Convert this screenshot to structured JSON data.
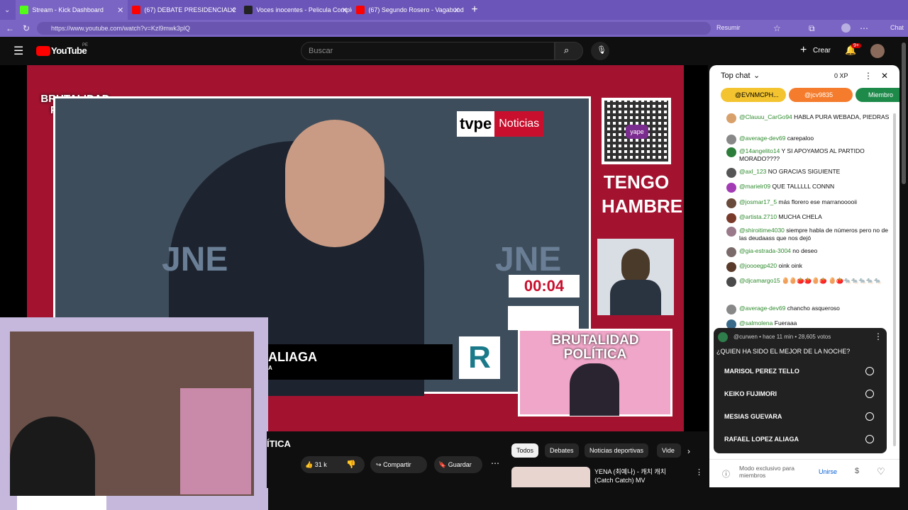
{
  "tabs": [
    {
      "title": "Stream - Kick Dashboard",
      "color": "#53fc18"
    },
    {
      "title": "(67) DEBATE PRESIDENCIAL 2",
      "color": "#ff0000"
    },
    {
      "title": "Voces inocentes - Pelicula Complet",
      "color": "#222222"
    },
    {
      "title": "(67) Segundo Rosero - Vagabunde",
      "color": "#ff0000"
    }
  ],
  "browser": {
    "url": "https://www.youtube.com/watch?v=Kzl9mwk3plQ",
    "resume": "Resumir",
    "chat": "Chat",
    "new_tab": "+"
  },
  "youtube": {
    "logo": "YouTube",
    "region": "PE",
    "search_placeholder": "Buscar",
    "create": "Crear",
    "notif": "9+"
  },
  "video": {
    "brand": "BRUTALIDAD POLÍTICA",
    "tv": "tvpe",
    "tv2": "Noticias",
    "timer": "00:04",
    "name": "ALIAGA",
    "name_sub": "A",
    "hunger": "TENGO HAMBRE",
    "qr_label": "yape",
    "pip_brand": "BRUTALIDAD POLÍTICA",
    "jne": "JNE",
    "jne2": "JNE",
    "badge": "R"
  },
  "below": {
    "title_fragment": "ÍTICA",
    "likes": "31 k",
    "share": "Compartir",
    "save": "Guardar",
    "chips": [
      "Todos",
      "Debates",
      "Noticias deportivas",
      "Vide"
    ],
    "rec_title": "YENA (최예나) - 캐치 캐치 (Catch Catch) MV"
  },
  "chat": {
    "header": "Top chat",
    "xp": "0 XP",
    "pinned": [
      "@EVNMCPH...",
      "@jcv9835",
      "Miembro"
    ],
    "messages": [
      {
        "user": "@Clauuu_CarGo94",
        "text": "HABLA PURA WEBADA, PIEDRAS",
        "color": "#d8a06a"
      },
      {
        "user": "@average-dev69",
        "text": "carepaloo",
        "color": "#888"
      },
      {
        "user": "@14angelito14",
        "text": "Y SI APOYAMOS AL PARTIDO MORADO????",
        "color": "#2d7d3a"
      },
      {
        "user": "@axl_123",
        "text": "NO GRACIAS SIGUIENTE",
        "color": "#555"
      },
      {
        "user": "@marielr09",
        "text": "QUE TALLLLL CONNN",
        "color": "#a33bb5"
      },
      {
        "user": "@josmar17_5",
        "text": "más florero ese marranooooii",
        "color": "#6a4a3a"
      },
      {
        "user": "@artista.2710",
        "text": "MUCHA CHELA",
        "color": "#7a3a2a"
      },
      {
        "user": "@shiroitime4030",
        "text": "siempre habla de números pero no de las deudaass que nos dejó",
        "color": "#9a7a8a"
      },
      {
        "user": "@gia-estrada-3004",
        "text": "no deseo",
        "color": "#7a6a6a"
      },
      {
        "user": "@joooegp420",
        "text": "oink oink",
        "color": "#5a3a2a"
      },
      {
        "user": "@djcamargo15",
        "text": "🥚🥚🍅🍅🥚🍅 🥚🍅🐀🐀🐀🐀🐀",
        "color": "#4a4a4a"
      },
      {
        "user": "@average-dev69",
        "text": "chancho asqueroso",
        "color": "#888"
      },
      {
        "user": "@salmolena",
        "text": "Fueraaa",
        "color": "#3a6a8a"
      }
    ],
    "poll": {
      "meta": "@curwen • hace 11 min • 28,605 votos",
      "question": "¿QUIEN HA SIDO EL MEJOR DE LA NOCHE?",
      "options": [
        "MARISOL PEREZ TELLO",
        "KEIKO FUJIMORI",
        "MESIAS GUEVARA",
        "RAFAEL LOPEZ ALIAGA"
      ]
    },
    "footer": "Modo exclusivo para miembros",
    "join": "Unirse"
  }
}
